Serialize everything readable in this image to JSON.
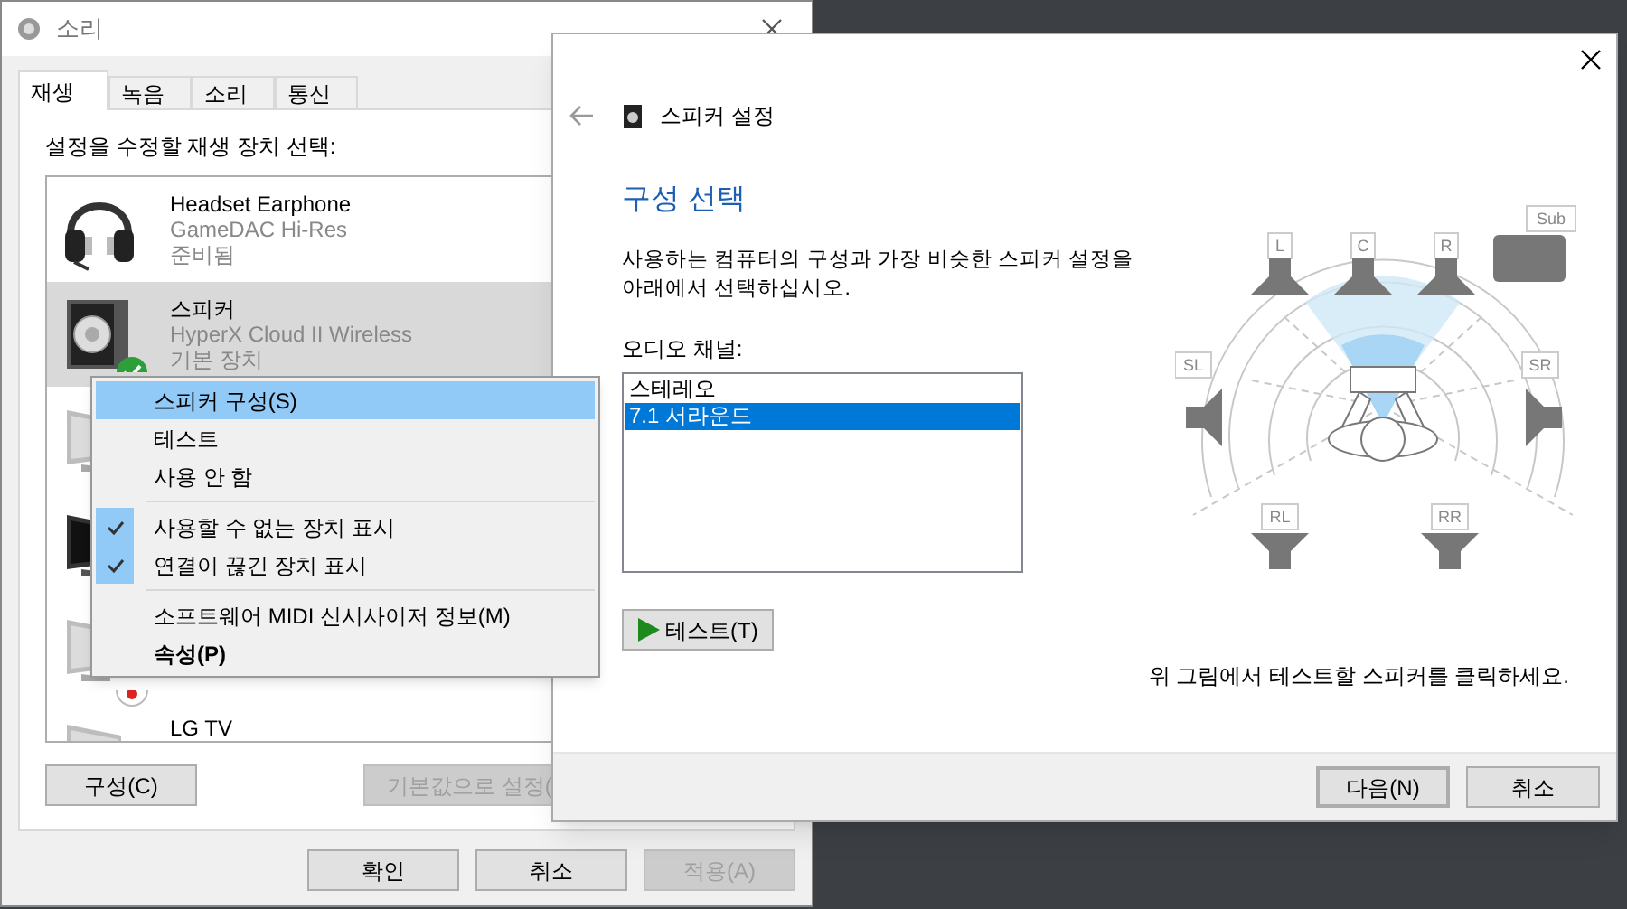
{
  "sound_window": {
    "title": "소리",
    "tabs": [
      {
        "label": "재생",
        "selected": true
      },
      {
        "label": "녹음",
        "selected": false
      },
      {
        "label": "소리",
        "selected": false
      },
      {
        "label": "통신",
        "selected": false
      }
    ],
    "prompt": "설정을 수정할 재생 장치 선택:",
    "devices": [
      {
        "kind": "headset",
        "name": "Headset Earphone",
        "description": "GameDAC Hi-Res",
        "status": "준비됨",
        "selected": false,
        "default": false
      },
      {
        "kind": "speaker",
        "name": "스피커",
        "description": "HyperX Cloud II Wireless",
        "status": "기본 장치",
        "selected": true,
        "default": true
      },
      {
        "kind": "monitor",
        "selected": false
      },
      {
        "kind": "monitor-dark",
        "selected": false
      },
      {
        "kind": "monitor",
        "selected": false,
        "default": false,
        "unplugged": true
      },
      {
        "kind": "monitor",
        "name": "LG TV",
        "selected": false
      }
    ],
    "buttons": [
      {
        "label": "구성(C)",
        "disabled": false
      },
      {
        "label": "기본값으로 설정(",
        "disabled": true
      }
    ],
    "footer_buttons": [
      {
        "label": "확인",
        "disabled": false
      },
      {
        "label": "취소",
        "disabled": false
      },
      {
        "label": "적용(A)",
        "disabled": true
      }
    ]
  },
  "context_menu": [
    {
      "kind": "item",
      "label": "스피커 구성(S)",
      "selected": true,
      "checked": false,
      "bold": false
    },
    {
      "kind": "item",
      "label": "테스트",
      "selected": false,
      "checked": false,
      "bold": false
    },
    {
      "kind": "item",
      "label": "사용 안 함",
      "selected": false,
      "checked": false,
      "bold": false
    },
    {
      "kind": "separator"
    },
    {
      "kind": "item",
      "label": "사용할 수 없는 장치 표시",
      "selected": false,
      "checked": true,
      "bold": false
    },
    {
      "kind": "item",
      "label": "연결이 끊긴 장치 표시",
      "selected": false,
      "checked": true,
      "bold": false
    },
    {
      "kind": "separator"
    },
    {
      "kind": "item",
      "label": "소프트웨어 MIDI 신시사이저 정보(M)",
      "selected": false,
      "checked": false,
      "bold": false
    },
    {
      "kind": "item",
      "label": "속성(P)",
      "selected": false,
      "checked": false,
      "bold": true
    }
  ],
  "speaker_setup": {
    "title": "스피커 설정",
    "heading": "구성 선택",
    "description": "사용하는 컴퓨터의 구성과 가장 비슷한 스피커 설정을 아래에서 선택하십시오.",
    "channels_label": "오디오 채널:",
    "channels": [
      {
        "label": "스테레오",
        "selected": false
      },
      {
        "label": "7.1 서라운드",
        "selected": true
      }
    ],
    "test_button": "테스트(T)",
    "speakers": [
      {
        "label": "L"
      },
      {
        "label": "C"
      },
      {
        "label": "R"
      },
      {
        "label": "Sub"
      },
      {
        "label": "SL"
      },
      {
        "label": "SR"
      },
      {
        "label": "RL"
      },
      {
        "label": "RR"
      }
    ],
    "hint": "위 그림에서 테스트할 스피커를 클릭하세요.",
    "buttons": [
      {
        "label": "다음(N)",
        "default": true
      },
      {
        "label": "취소",
        "default": false
      }
    ]
  }
}
